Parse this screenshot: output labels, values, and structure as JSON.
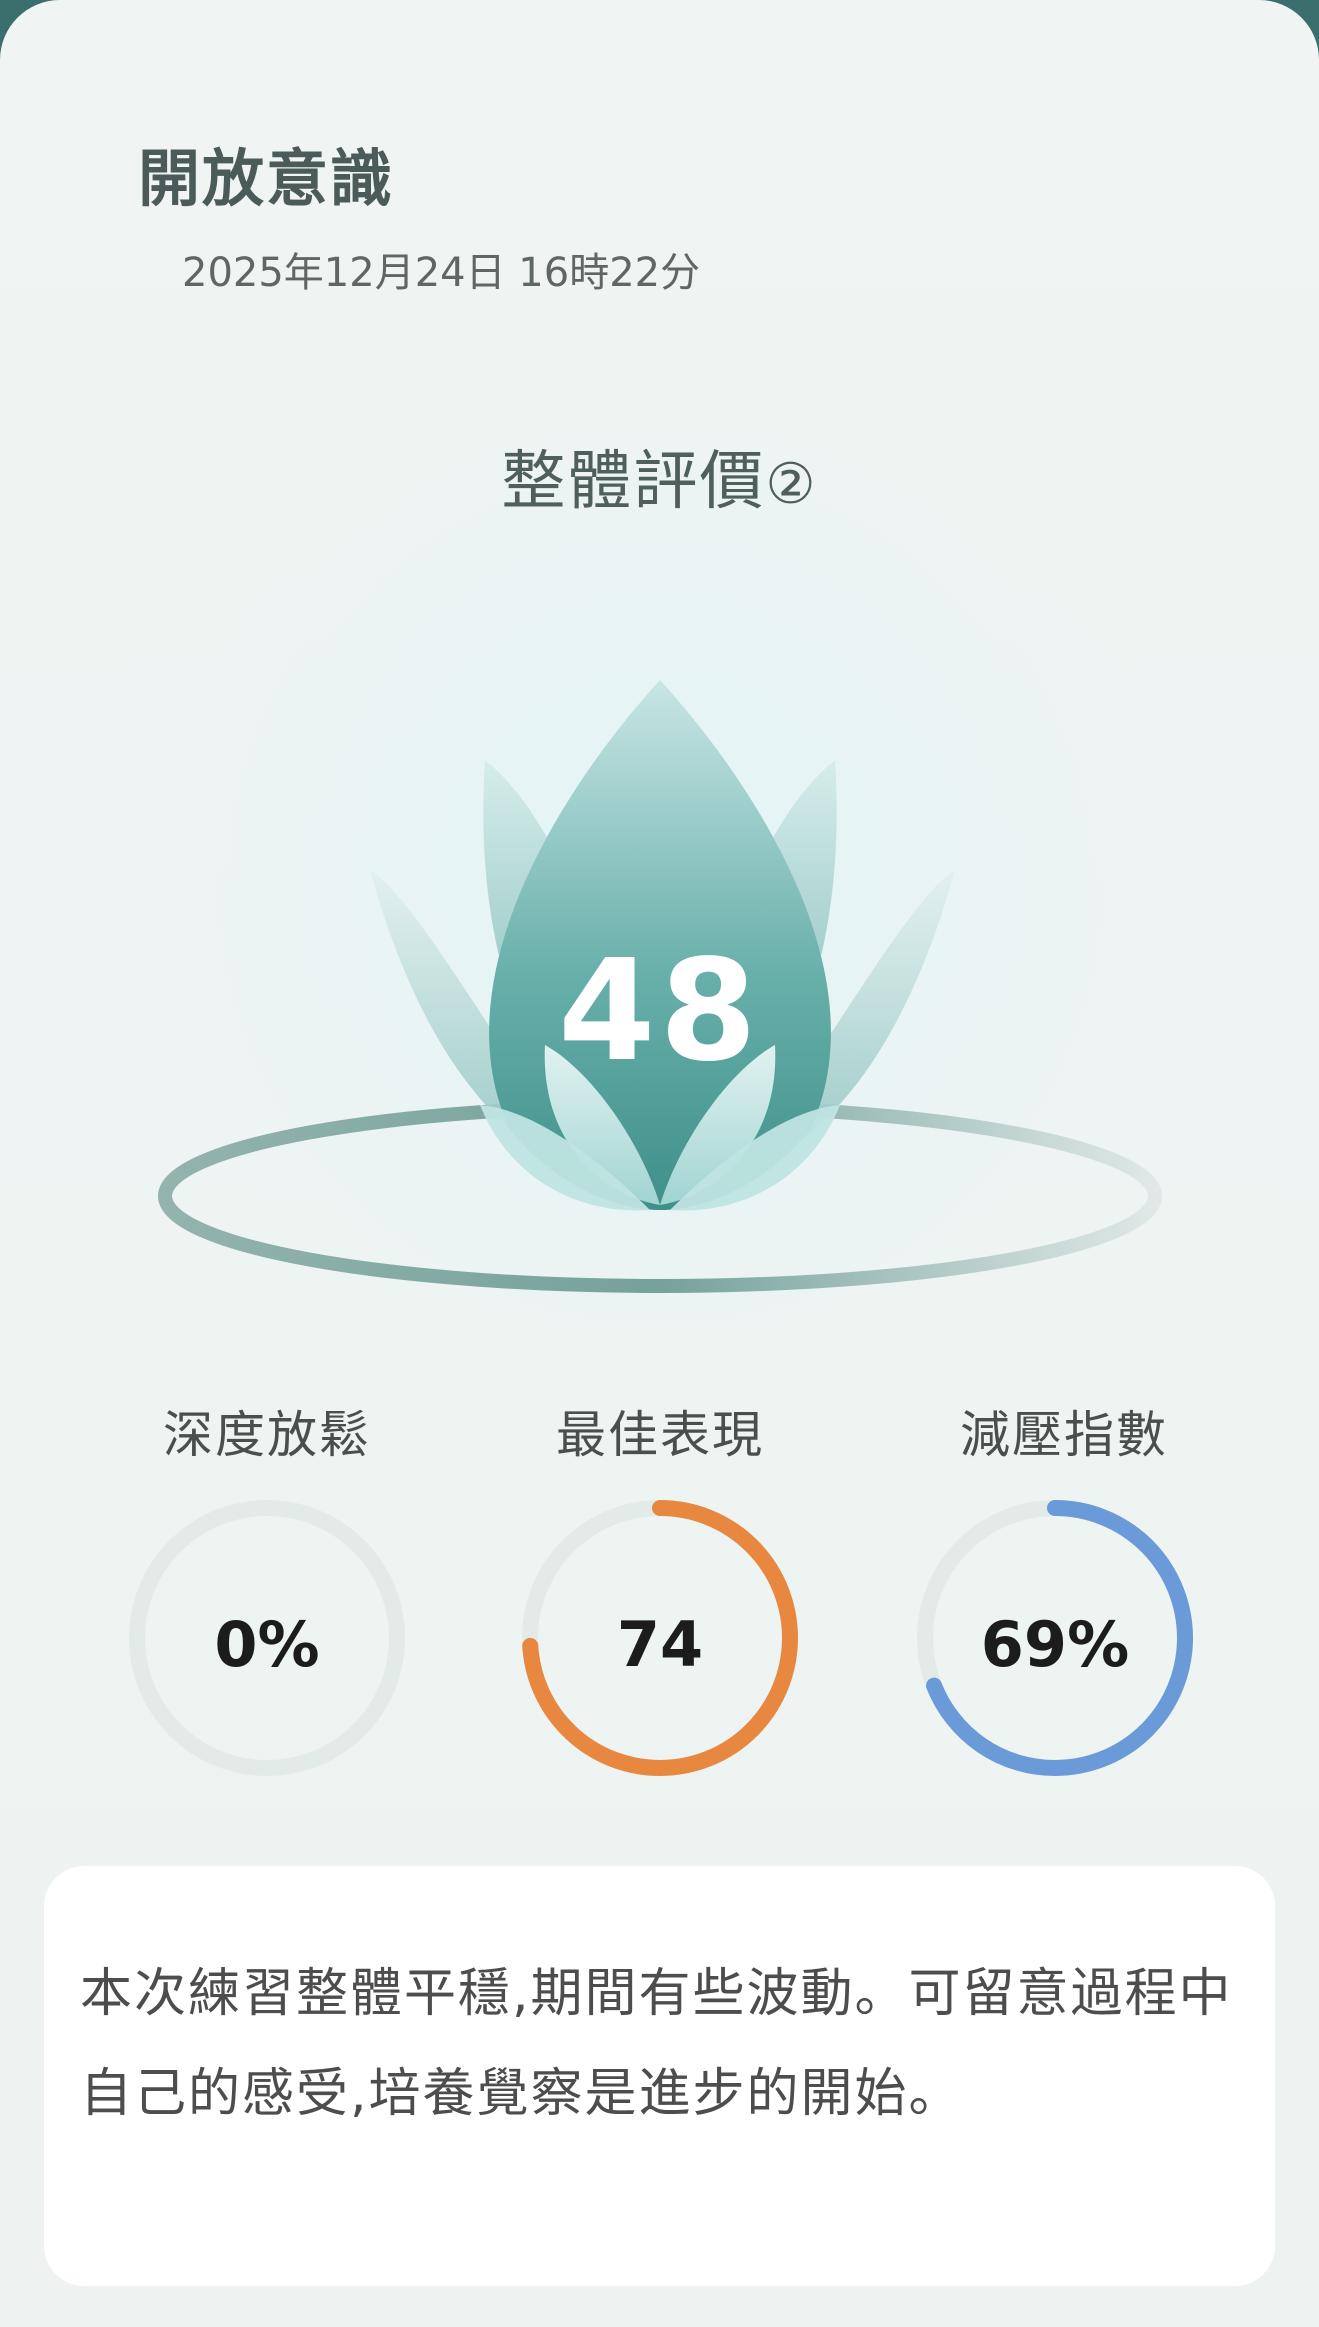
{
  "header": {
    "title": "開放意識",
    "datetime": "2025年12月24日 16時22分"
  },
  "evaluation": {
    "title": "整體評價",
    "help_icon": "②",
    "score": "48"
  },
  "metrics": [
    {
      "label": "深度放鬆",
      "value_text": "0%",
      "progress": 0.0,
      "color": "#e3ebe8"
    },
    {
      "label": "最佳表現",
      "value_text": "74",
      "progress": 0.74,
      "color": "#e88840"
    },
    {
      "label": "減壓指數",
      "value_text": "69%",
      "progress": 0.69,
      "color": "#6a9ad8"
    }
  ],
  "comment": {
    "text": "本次練習整體平穩,期間有些波動。可留意過程中自己的感受,培養覺察是進步的開始。"
  }
}
